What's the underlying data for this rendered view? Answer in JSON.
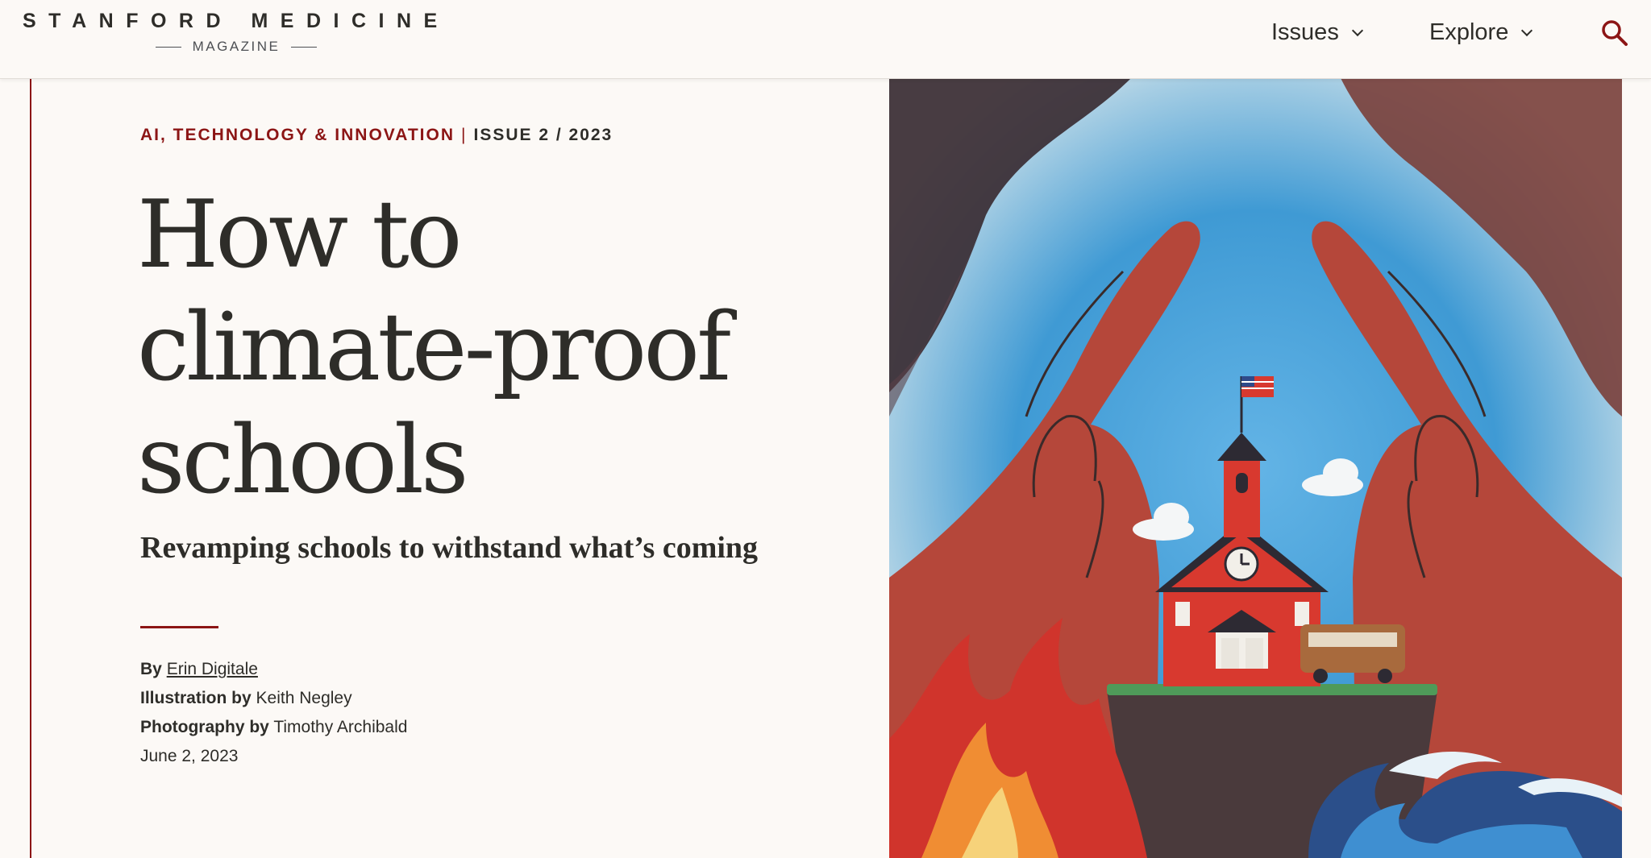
{
  "header": {
    "logo_main": "STANFORD MEDICINE",
    "logo_sub": "MAGAZINE",
    "nav": [
      {
        "label": "Issues",
        "icon": "chevron-down-icon"
      },
      {
        "label": "Explore",
        "icon": "chevron-down-icon"
      }
    ],
    "search_icon": "search-icon"
  },
  "article": {
    "topic": "AI, TECHNOLOGY & INNOVATION",
    "separator": "|",
    "issue": "ISSUE 2 / 2023",
    "title_lines": [
      "How to",
      "climate-proof",
      "schools"
    ],
    "subtitle": "Revamping schools to withstand what’s coming",
    "byline": {
      "by_label": "By",
      "author": "Erin Digitale",
      "illustration_label": "Illustration by",
      "illustrator": "Keith Negley",
      "photography_label": "Photography by",
      "photographer": "Timothy Archibald",
      "date": "June 2, 2023"
    }
  },
  "hero": {
    "description_icon": "schoolhouse-illustration"
  },
  "colors": {
    "background": "#fcf9f6",
    "accent": "#8c1515",
    "text": "#2e2d29",
    "sky": "#3d9ad6",
    "hands": "#b5473a"
  }
}
